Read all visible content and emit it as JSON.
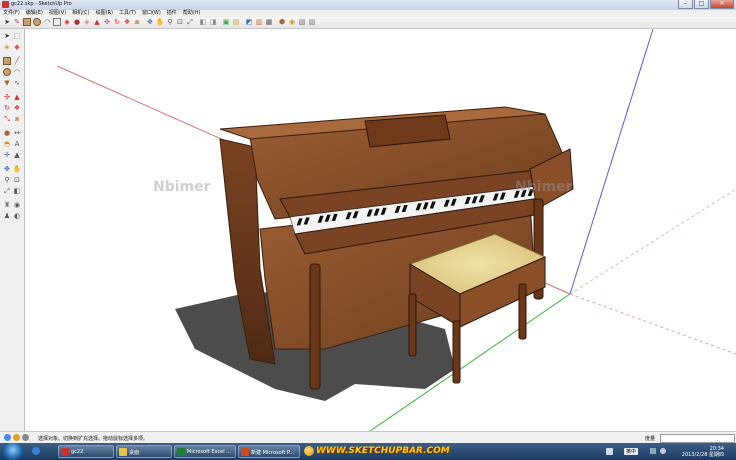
{
  "window": {
    "title": "gc22.skp - SketchUp Pro",
    "min_glyph": "–",
    "max_glyph": "□",
    "close_glyph": "✕"
  },
  "menubar": {
    "items": [
      "文件(F)",
      "编辑(E)",
      "视图(V)",
      "相机(C)",
      "绘图(R)",
      "工具(T)",
      "窗口(W)",
      "插件",
      "帮助(H)"
    ]
  },
  "viewport": {
    "watermark": "Nbimer",
    "axis_colors": {
      "red": "#e07070",
      "green": "#3bb33b",
      "blue": "#5a5ad8"
    }
  },
  "statusbar": {
    "hint": "选择对象。切换到扩充选择。拖动鼠标选择多项。",
    "measurement_label": "度量",
    "measurement_value": ""
  },
  "taskbar": {
    "items": [
      {
        "label": "gc22",
        "icon": "sketchup-icon",
        "color": "#c8322f"
      },
      {
        "label": "桌面",
        "icon": "folder-icon",
        "color": "#e8c24a"
      },
      {
        "label": "Microsoft Excel ...",
        "icon": "excel-icon",
        "color": "#1e7e34"
      },
      {
        "label": "新建 Microsoft P...",
        "icon": "powerpoint-icon",
        "color": "#d04a1e"
      }
    ],
    "banner_text": "WWW.SKETCHUPBAR.COM",
    "language": "英中",
    "clock_time": "20:34",
    "clock_date": "2013/2/28 星期四"
  }
}
